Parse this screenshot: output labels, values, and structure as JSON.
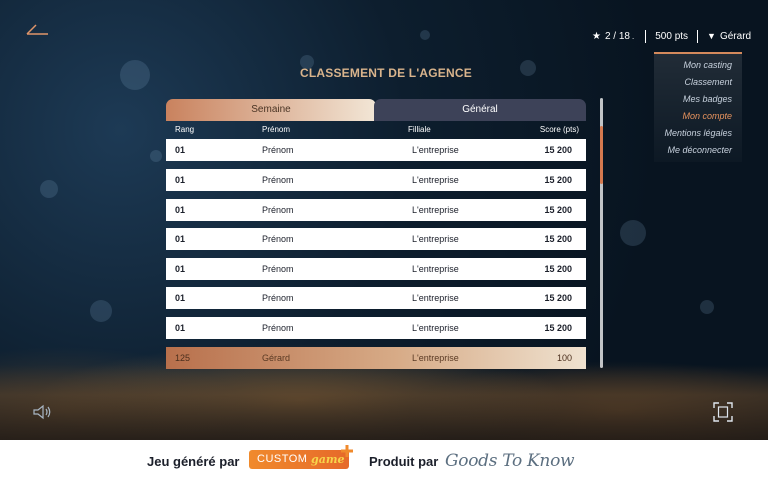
{
  "header": {
    "title": "CLASSEMENT DE L'AGENCE",
    "progress": "2 / 18",
    "points": "500 pts",
    "user": "Gérard"
  },
  "menu": {
    "items": [
      {
        "label": "Mon casting",
        "active": false
      },
      {
        "label": "Classement",
        "active": false
      },
      {
        "label": "Mes badges",
        "active": false
      },
      {
        "label": "Mon compte",
        "active": true
      },
      {
        "label": "Mentions légales",
        "active": false
      },
      {
        "label": "Me déconnecter",
        "active": false
      }
    ]
  },
  "tabs": {
    "week": "Semaine",
    "general": "Général",
    "selected": "week"
  },
  "table": {
    "columns": [
      "Rang",
      "Prénom",
      "Filliale",
      "Score (pts)"
    ],
    "rows": [
      {
        "rank": "01",
        "name": "Prénom",
        "company": "L'entreprise",
        "score": "15 200"
      },
      {
        "rank": "01",
        "name": "Prénom",
        "company": "L'entreprise",
        "score": "15 200"
      },
      {
        "rank": "01",
        "name": "Prénom",
        "company": "L'entreprise",
        "score": "15 200"
      },
      {
        "rank": "01",
        "name": "Prénom",
        "company": "L'entreprise",
        "score": "15 200"
      },
      {
        "rank": "01",
        "name": "Prénom",
        "company": "L'entreprise",
        "score": "15 200"
      },
      {
        "rank": "01",
        "name": "Prénom",
        "company": "L'entreprise",
        "score": "15 200"
      },
      {
        "rank": "01",
        "name": "Prénom",
        "company": "L'entreprise",
        "score": "15 200"
      }
    ],
    "current_user_row": {
      "rank": "125",
      "name": "Gérard",
      "company": "L'entreprise",
      "score": "100"
    }
  },
  "icons": {
    "back": "back-arrow-icon",
    "star": "star-icon",
    "caret": "caret-down-icon",
    "sound": "sound-icon",
    "fullscreen": "fullscreen-icon"
  },
  "colors": {
    "accent": "#d4794f",
    "title": "#d9b48c",
    "tab_general": "#3d4258"
  },
  "footer": {
    "generated_by": "Jeu généré par",
    "custom_logo_word1": "CUSTOM",
    "custom_logo_word2": "game",
    "produced_by": "Produit par",
    "gtk_logo": "Goods To Know"
  }
}
